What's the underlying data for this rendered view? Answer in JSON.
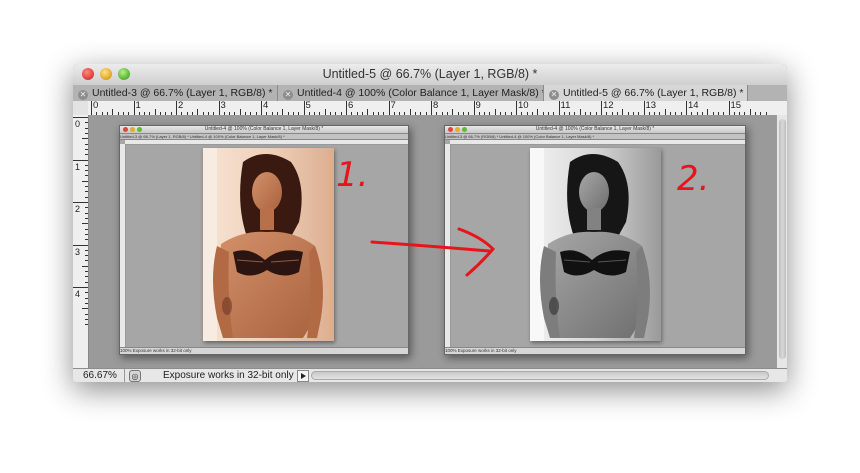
{
  "window": {
    "title": "Untitled-5 @ 66.7% (Layer 1, RGB/8) *",
    "tabs": [
      {
        "label": "Untitled-3 @ 66.7% (Layer 1, RGB/8) *",
        "active": false
      },
      {
        "label": "Untitled-4 @ 100% (Color Balance 1, Layer Mask/8) *",
        "active": false
      },
      {
        "label": "Untitled-5 @ 66.7% (Layer 1, RGB/8) *",
        "active": true
      }
    ]
  },
  "ruler": {
    "top_numbers": [
      "0",
      "1",
      "2",
      "3",
      "4",
      "5",
      "6",
      "7",
      "8",
      "9",
      "10",
      "11",
      "12",
      "13",
      "14",
      "15"
    ],
    "left_numbers": [
      "0",
      "1",
      "2",
      "3",
      "4"
    ]
  },
  "documents": [
    {
      "title": "Untitled-4 @ 100% (Color Balance 1, Layer Mask/8) *",
      "tabs": "Untitled-3 @ 66.7% (Layer 1, RGB/8) *   Untitled-4 @ 100% (Color Balance 1, Layer Mask/8) *",
      "status": "100%   Exposure works in 32-bit only",
      "photo_tone": "sepia",
      "annotation": "1."
    },
    {
      "title": "Untitled-4 @ 100% (Color Balance 1, Layer Mask/8) *",
      "tabs": "Untitled-3 @ 66.7% (RGB/8) *   Untitled-4 @ 100% (Color Balance 1, Layer Mask/8) *",
      "status": "100%   Exposure works in 32-bit only",
      "photo_tone": "black-and-white",
      "annotation": "2."
    }
  ],
  "status": {
    "zoom": "66.67%",
    "info": "Exposure works in 32-bit only"
  },
  "colors": {
    "annotation_red": "#e8141c",
    "canvas_gray": "#9a9a9a"
  }
}
